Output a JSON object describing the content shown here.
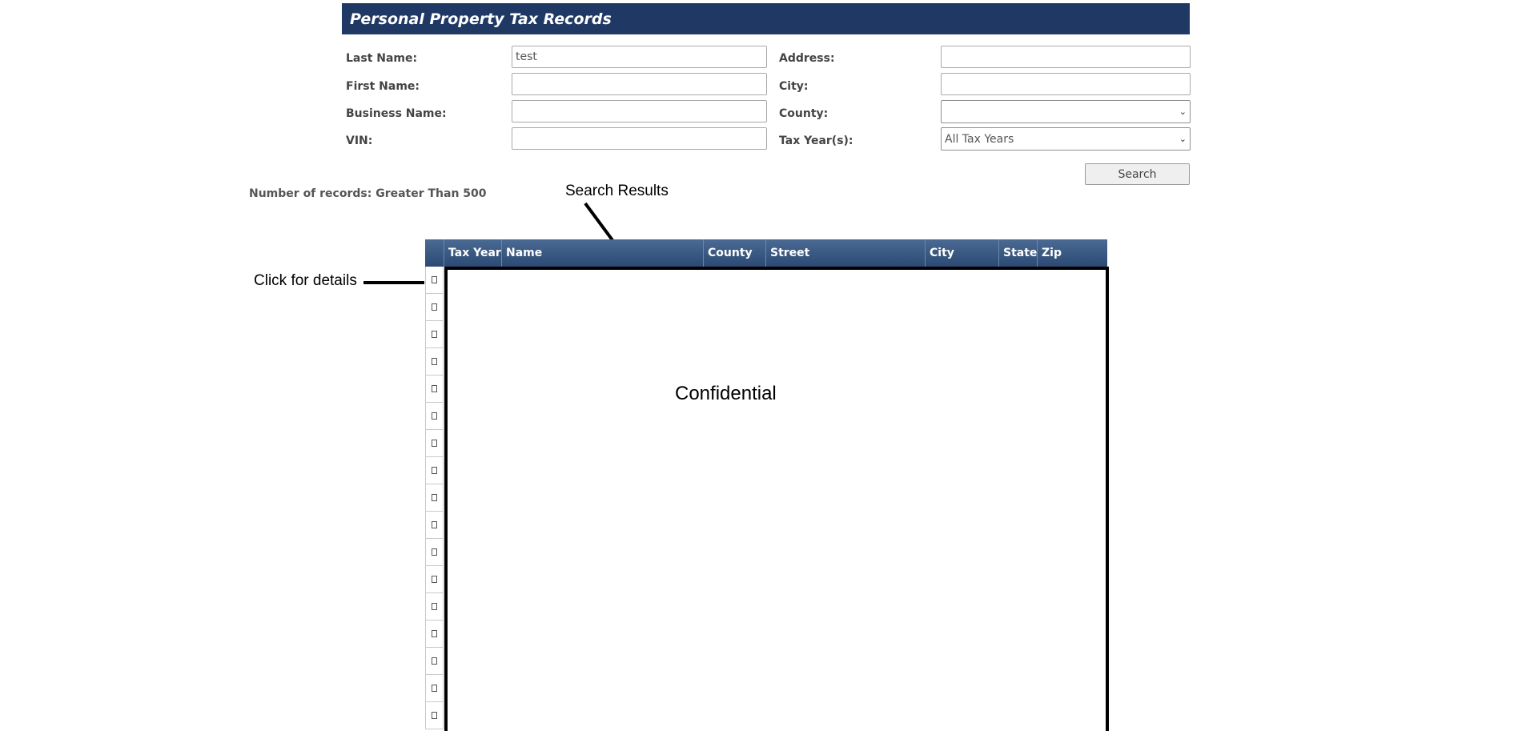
{
  "header": {
    "title": "Personal Property Tax Records"
  },
  "form": {
    "last_name_label": "Last Name:",
    "last_name_value": "test",
    "first_name_label": "First Name:",
    "first_name_value": "",
    "business_name_label": "Business Name:",
    "business_name_value": "",
    "vin_label": "VIN:",
    "vin_value": "",
    "address_label": "Address:",
    "address_value": "",
    "city_label": "City:",
    "city_value": "",
    "county_label": "County:",
    "county_selected": "",
    "tax_year_label": "Tax Year(s):",
    "tax_year_selected": "All Tax Years",
    "search_label": "Search"
  },
  "records_count": "Number of records: Greater Than 500",
  "annotations": {
    "search_results": "Search Results",
    "click_for_details": "Click for details",
    "confidential": "Confidential"
  },
  "grid": {
    "columns": [
      "Tax Year",
      "Name",
      "County",
      "Street",
      "City",
      "State",
      "Zip"
    ],
    "row_count": 17
  },
  "colors": {
    "header_bg": "#1f3864",
    "grid_header": "#3b5a83"
  }
}
